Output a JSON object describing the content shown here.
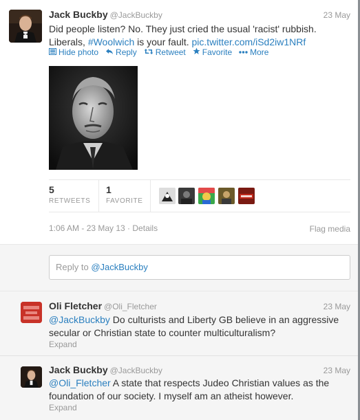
{
  "main_tweet": {
    "name": "Jack Buckby",
    "handle": "@JackBuckby",
    "date": "23 May",
    "text_line1": "Did people listen? No. They just cried the usual 'racist' rubbish.",
    "text_line2_prefix": "Liberals, ",
    "hashtag": "#Woolwich",
    "text_line2_mid": " is your fault. ",
    "pic_link": "pic.twitter.com/iSd2iw1NRf",
    "actions": {
      "hide_photo": "Hide photo",
      "reply": "Reply",
      "retweet": "Retweet",
      "favorite": "Favorite",
      "more": "More"
    },
    "retweets_count": "5",
    "retweets_label": "RETWEETS",
    "favorites_count": "1",
    "favorites_label": "FAVORITE",
    "timestamp": "1:06 AM - 23 May 13 · Details",
    "flag_media": "Flag media"
  },
  "reply_box": {
    "prefix": "Reply to ",
    "mention": "@JackBuckby"
  },
  "replies": [
    {
      "name": "Oli Fletcher",
      "handle": "@Oli_Fletcher",
      "date": "23 May",
      "mention": "@JackBuckby",
      "text_line1": " Do culturists and Liberty GB believe in an aggressive",
      "text_line2": "secular or Christian state to counter multiculturalism?",
      "expand": "Expand"
    },
    {
      "name": "Jack Buckby",
      "handle": "@JackBuckby",
      "date": "23 May",
      "mention": "@Oli_Fletcher",
      "text_line1": " A state that respects Judeo Christian values as the",
      "text_line2": "foundation of our society. I myself am an atheist however.",
      "expand": "Expand"
    }
  ],
  "icons": {
    "hide_photo": "photo-icon",
    "reply": "reply-arrow-icon",
    "retweet": "retweet-icon",
    "favorite": "star-icon",
    "more": "dots-icon"
  },
  "colors": {
    "link": "#2a7fbf",
    "muted": "#999999",
    "reply_bg": "#f5f5f5"
  }
}
